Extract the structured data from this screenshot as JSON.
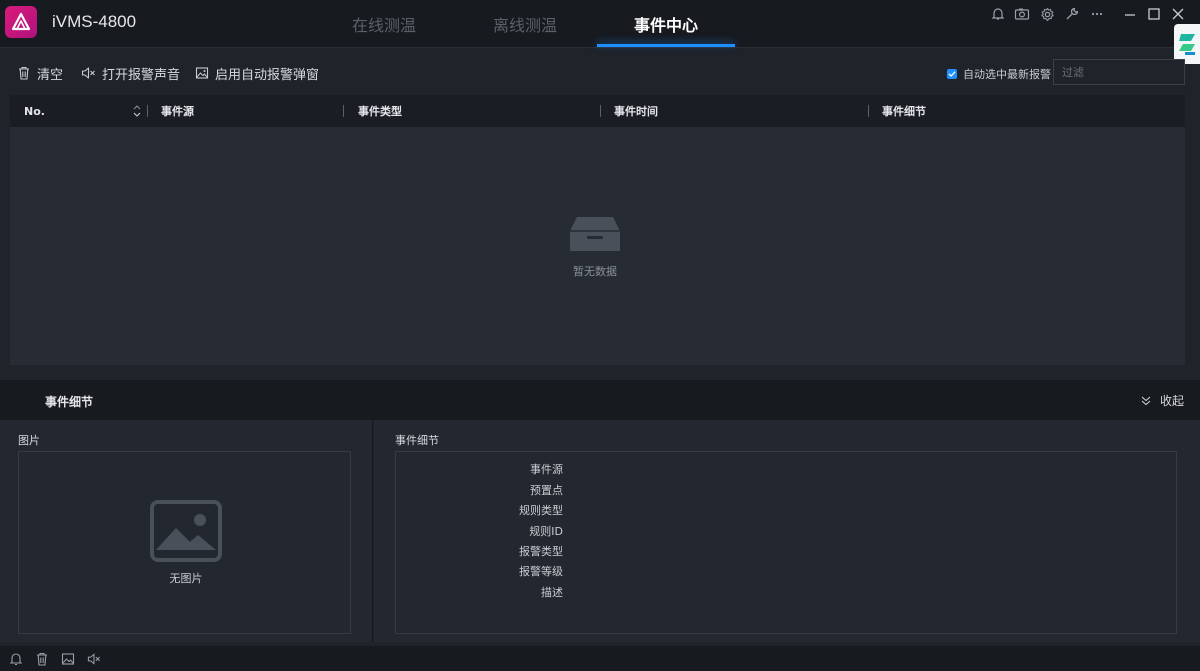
{
  "app": {
    "name": "iVMS-4800"
  },
  "tabs": [
    {
      "label": "在线测温",
      "active": false
    },
    {
      "label": "离线测温",
      "active": false
    },
    {
      "label": "事件中心",
      "active": true
    }
  ],
  "window_controls": [
    "bell-icon",
    "camera-icon",
    "gear-icon",
    "wrench-icon",
    "more-icon",
    "minimize-icon",
    "maximize-icon",
    "close-icon"
  ],
  "toolbar": {
    "clear_label": "清空",
    "sound_label": "打开报警声音",
    "popup_label": "启用自动报警弹窗",
    "auto_select_label": "自动选中最新报警",
    "auto_select_checked": true,
    "filter_placeholder": "过滤",
    "filter_value": ""
  },
  "table": {
    "columns": [
      "No.",
      "事件源",
      "事件类型",
      "事件时间",
      "事件细节"
    ],
    "rows": [],
    "empty_text": "暂无数据"
  },
  "detail": {
    "title": "事件细节",
    "collapse_label": "收起",
    "picture_label": "图片",
    "no_picture_text": "无图片",
    "info_label": "事件细节",
    "fields": [
      "事件源",
      "预置点",
      "规则类型",
      "规则ID",
      "报警类型",
      "报警等级",
      "描述"
    ]
  },
  "colors": {
    "accent": "#1e8fff",
    "logo": "#d81b7a",
    "background": "#1f232a"
  }
}
